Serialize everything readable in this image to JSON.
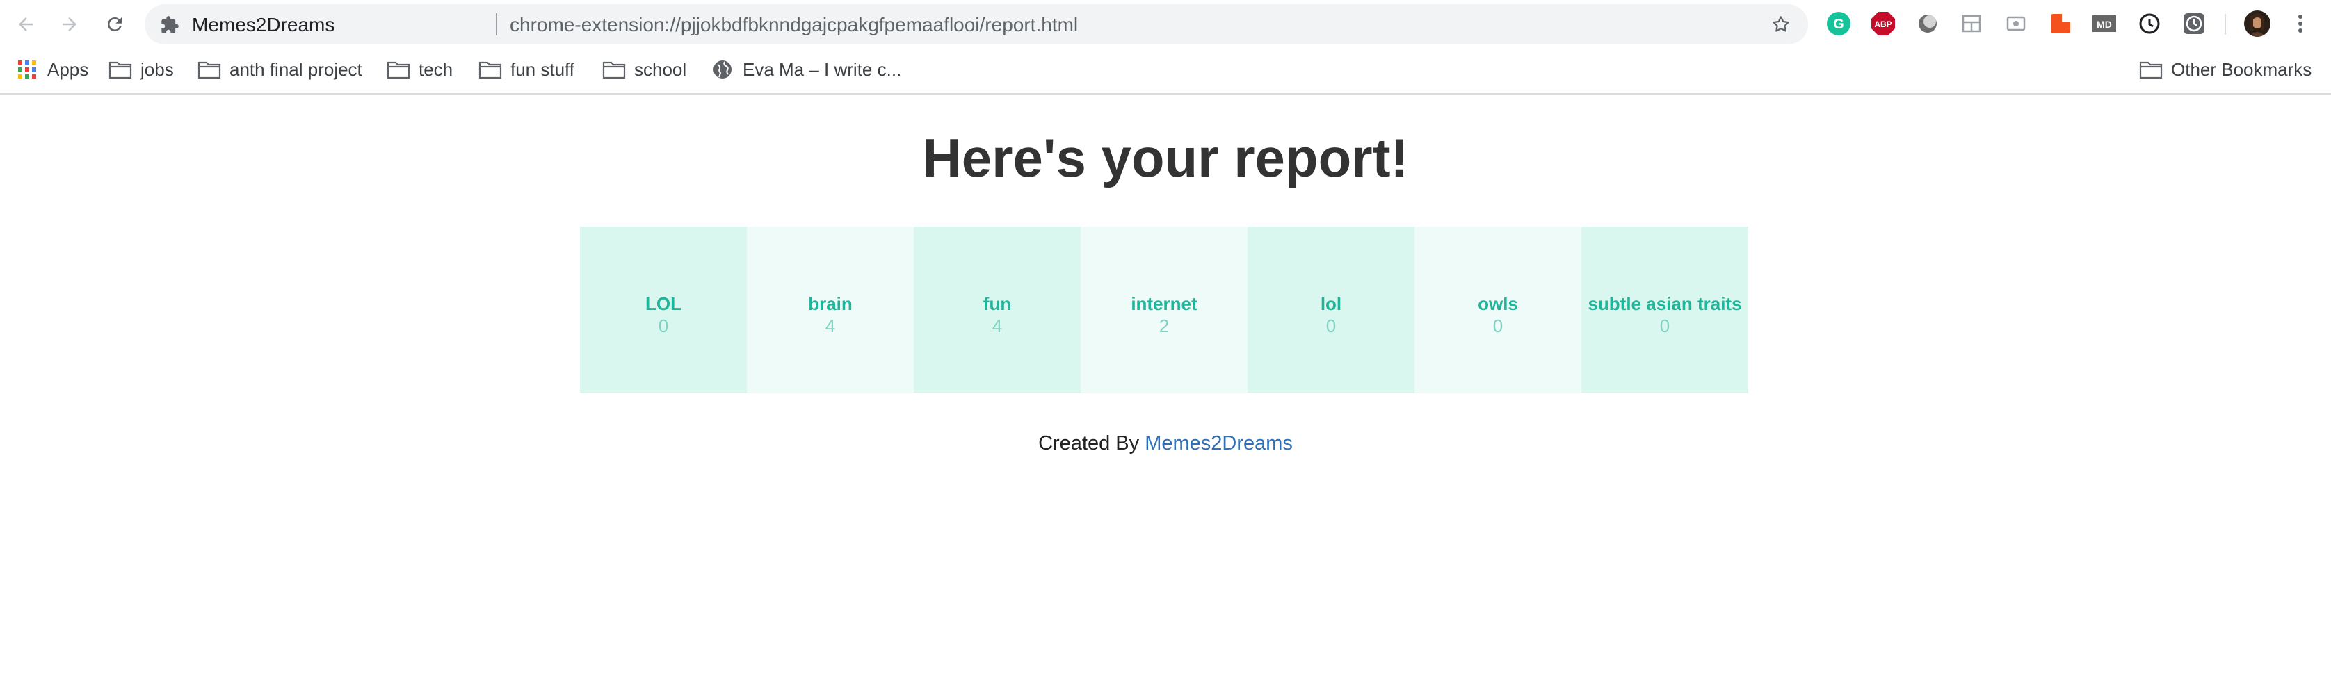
{
  "browser": {
    "site_name": "Memes2Dreams",
    "url": "chrome-extension://pjjokbdfbknndgajcpakgfpemaaflooi/report.html",
    "icons": {
      "back": "arrow-left-icon",
      "forward": "arrow-right-icon",
      "reload": "reload-icon",
      "site": "puzzle-piece-icon",
      "bookmark": "star-icon",
      "menu": "kebab-menu-icon"
    },
    "extensions": [
      {
        "name": "grammarly-icon",
        "color": "#15c39a"
      },
      {
        "name": "adblock-plus-icon",
        "label": "ABP",
        "color": "#c70d2c"
      },
      {
        "name": "dark-reader-icon",
        "color": "#555555"
      },
      {
        "name": "layout-icon",
        "color": "#9aa0a6"
      },
      {
        "name": "media-icon",
        "color": "#9aa0a6"
      },
      {
        "name": "extension-orange-icon",
        "color": "#f4511e"
      },
      {
        "name": "markdown-icon",
        "label": "MD",
        "color": "#666666"
      },
      {
        "name": "clock-icon",
        "color": "#202124"
      },
      {
        "name": "timer-icon",
        "color": "#5f6368"
      },
      {
        "name": "profile-avatar-icon",
        "color": "#6b4b3a"
      }
    ]
  },
  "bookmarks": {
    "items": [
      {
        "label": "Apps",
        "icon": "apps-grid-icon"
      },
      {
        "label": "jobs",
        "icon": "folder-icon"
      },
      {
        "label": "anth final project",
        "icon": "folder-icon"
      },
      {
        "label": "tech",
        "icon": "folder-icon"
      },
      {
        "label": "fun stuff",
        "icon": "folder-icon"
      },
      {
        "label": "school",
        "icon": "folder-icon"
      },
      {
        "label": "Eva Ma – I write c...",
        "icon": "globe-icon"
      }
    ],
    "other": {
      "label": "Other Bookmarks",
      "icon": "folder-icon"
    }
  },
  "page": {
    "title": "Here's your report!",
    "categories": [
      {
        "name": "LOL",
        "count": "0"
      },
      {
        "name": "brain",
        "count": "4"
      },
      {
        "name": "fun",
        "count": "4"
      },
      {
        "name": "internet",
        "count": "2"
      },
      {
        "name": "lol",
        "count": "0"
      },
      {
        "name": "owls",
        "count": "0"
      },
      {
        "name": "subtle asian traits",
        "count": "0"
      }
    ],
    "footer": {
      "prefix": "Created By",
      "link": "Memes2Dreams"
    }
  }
}
